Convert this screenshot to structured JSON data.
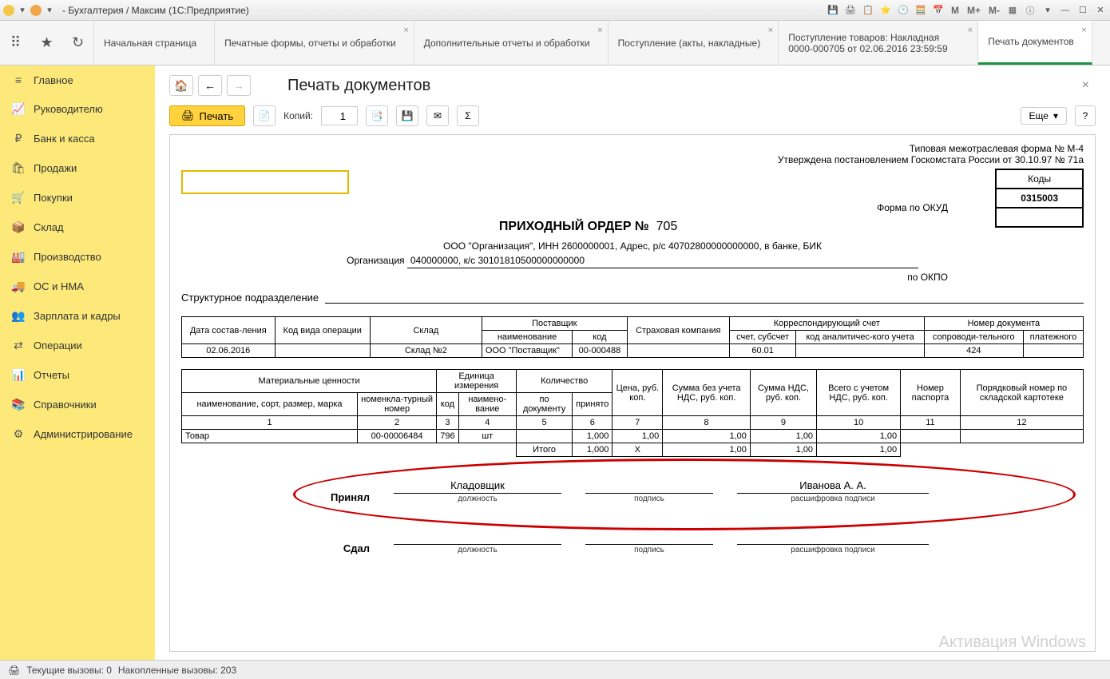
{
  "title": "- Бухгалтерия / Максим  (1С:Предприятие)",
  "tabs": [
    {
      "label": "Начальная страница"
    },
    {
      "label": "Печатные формы, отчеты и обработки"
    },
    {
      "label": "Дополнительные отчеты и обработки"
    },
    {
      "label": "Поступление (акты, накладные)"
    },
    {
      "label": "Поступление товаров: Накладная 0000-000705 от 02.06.2016 23:59:59"
    },
    {
      "label": "Печать документов"
    }
  ],
  "sidebar": [
    {
      "icon": "≡",
      "label": "Главное"
    },
    {
      "icon": "📈",
      "label": "Руководителю"
    },
    {
      "icon": "₽",
      "label": "Банк и касса"
    },
    {
      "icon": "🛍",
      "label": "Продажи"
    },
    {
      "icon": "🛒",
      "label": "Покупки"
    },
    {
      "icon": "📦",
      "label": "Склад"
    },
    {
      "icon": "🏭",
      "label": "Производство"
    },
    {
      "icon": "🚚",
      "label": "ОС и НМА"
    },
    {
      "icon": "👥",
      "label": "Зарплата и кадры"
    },
    {
      "icon": "⇄",
      "label": "Операции"
    },
    {
      "icon": "📊",
      "label": "Отчеты"
    },
    {
      "icon": "📚",
      "label": "Справочники"
    },
    {
      "icon": "⚙",
      "label": "Администрирование"
    }
  ],
  "page": {
    "title": "Печать документов",
    "print_btn": "Печать",
    "copies_label": "Копий:",
    "copies_value": "1",
    "more_label": "Еще"
  },
  "doc": {
    "form_note1": "Типовая межотраслевая форма № М-4",
    "form_note2": "Утверждена постановлением Госкомстата России от 30.10.97 № 71а",
    "codes_head": "Коды",
    "okud_label": "Форма по ОКУД",
    "okud_value": "0315003",
    "okpo_label": "по ОКПО",
    "title": "ПРИХОДНЫЙ ОРДЕР №",
    "number": "705",
    "org_label": "Организация",
    "org_line1": "ООО \"Организация\", ИНН 2600000001, Адрес, р/с 40702800000000000, в банке, БИК",
    "org_line2": "040000000, к/с 30101810500000000000",
    "struct_label": "Структурное подразделение",
    "h": {
      "date": "Дата состав-ления",
      "opcode": "Код вида операции",
      "sklad": "Склад",
      "supplier": "Поставщик",
      "supplier_name": "наименование",
      "supplier_code": "код",
      "insurance": "Страховая компания",
      "corr": "Корреспондирующий счет",
      "corr_acct": "счет, субсчет",
      "corr_anal": "код аналитичес-кого учета",
      "docnum": "Номер документа",
      "docnum_accomp": "сопроводи-тельного",
      "docnum_pay": "платежного"
    },
    "r": {
      "date": "02.06.2016",
      "sklad": "Склад №2",
      "supplier_name": "ООО \"Поставщик\"",
      "supplier_code": "00-000488",
      "corr_acct": "60.01",
      "docnum_accomp": "424"
    },
    "g": {
      "mat": "Материальные ценности",
      "mat_name": "наименование, сорт, размер, марка",
      "mat_num": "номенкла-турный номер",
      "unit": "Единица измерения",
      "unit_code": "код",
      "unit_name": "наимено-вание",
      "qty": "Количество",
      "qty_doc": "по документу",
      "qty_acc": "принято",
      "price": "Цена, руб. коп.",
      "sum_novat": "Сумма без учета НДС, руб. коп.",
      "sum_vat": "Сумма НДС, руб. коп.",
      "sum_total": "Всего с учетом НДС, руб. коп.",
      "passport": "Номер паспорта",
      "order": "Порядковый номер по складской картотеке"
    },
    "cols": [
      "1",
      "2",
      "3",
      "4",
      "5",
      "6",
      "7",
      "8",
      "9",
      "10",
      "11",
      "12"
    ],
    "row": {
      "name": "Товар",
      "num": "00-00006484",
      "unit_code": "796",
      "unit_name": "шт",
      "qty_acc": "1,000",
      "price": "1,00",
      "sum_novat": "1,00",
      "sum_vat": "1,00",
      "sum_total": "1,00"
    },
    "totals": {
      "label": "Итого",
      "qty": "1,000",
      "price": "X",
      "sum_novat": "1,00",
      "sum_vat": "1,00",
      "sum_total": "1,00"
    },
    "sign": {
      "accepted": "Принял",
      "gave": "Сдал",
      "position": "Кладовщик",
      "name": "Иванова А. А.",
      "sub_pos": "должность",
      "sub_sign": "подпись",
      "sub_name": "расшифровка подписи"
    }
  },
  "status": {
    "current": "Текущие вызовы: 0",
    "accum": "Накопленные вызовы: 203"
  },
  "watermark": "Активация Windows"
}
